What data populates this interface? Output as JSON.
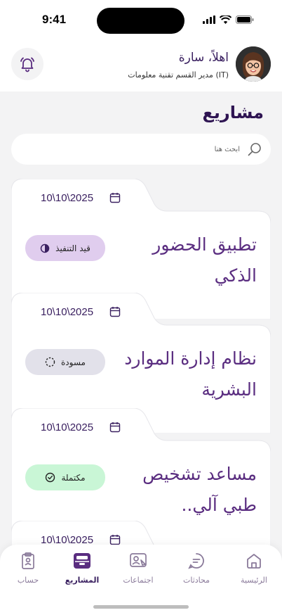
{
  "status_bar": {
    "time": "9:41"
  },
  "header": {
    "greeting": "اهلاً، سارة",
    "role": "مدير القسم تقنية معلومات (IT)"
  },
  "page_title": "مشاريع",
  "search": {
    "placeholder": "ابحث هنا"
  },
  "projects": [
    {
      "date": "10\\10\\2025",
      "title": "تطبيق الحضور الذكي",
      "status": "قيد التنفيذ",
      "status_color": "#e0cdee"
    },
    {
      "date": "10\\10\\2025",
      "title": "نظام إدارة الموارد البشرية",
      "status": "مسودة",
      "status_color": "#e2e1ea"
    },
    {
      "date": "10\\10\\2025",
      "title": "مساعد تشخيص طبي آلي..",
      "status": "مكتملة",
      "status_color": "#c9f6d6"
    },
    {
      "date": "10\\10\\2025"
    }
  ],
  "nav": {
    "home": "الرئيسية",
    "chats": "محادثات",
    "meetings": "اجتماعات",
    "projects": "المشاريع",
    "account": "حساب"
  },
  "colors": {
    "primary": "#3a2060",
    "accent": "#5a2d80"
  }
}
